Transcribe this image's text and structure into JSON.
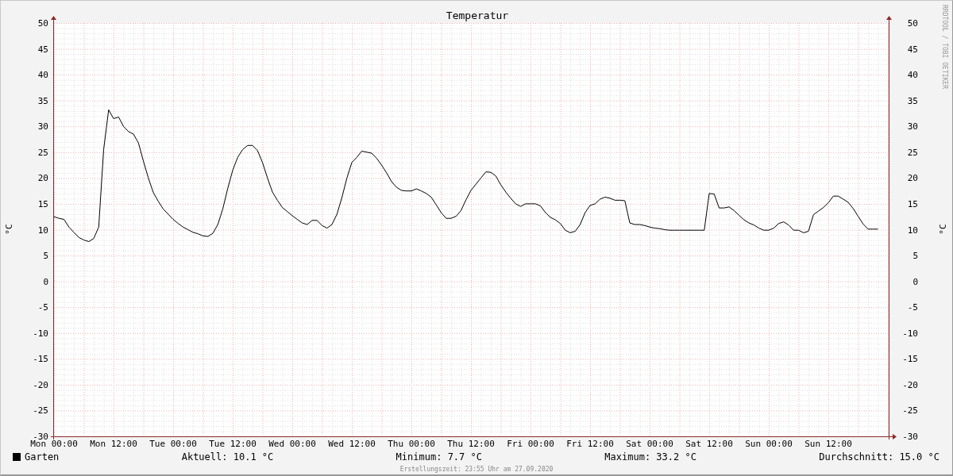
{
  "chart": {
    "chart_data": {
      "type": "line",
      "title": "Temperatur",
      "ylabel": "°C",
      "ylim": [
        -30,
        50
      ],
      "grid": true,
      "yticks": [
        -30,
        -25,
        -20,
        -15,
        -10,
        -5,
        0,
        5,
        10,
        15,
        20,
        25,
        30,
        35,
        40,
        45,
        50
      ],
      "categories": [
        "Mon 00:00",
        null,
        null,
        null,
        null,
        null,
        null,
        null,
        null,
        null,
        null,
        null,
        "Mon 12:00",
        null,
        null,
        null,
        null,
        null,
        null,
        null,
        null,
        null,
        null,
        null,
        "Tue 00:00",
        null,
        null,
        null,
        null,
        null,
        null,
        null,
        null,
        null,
        null,
        null,
        "Tue 12:00",
        null,
        null,
        null,
        null,
        null,
        null,
        null,
        null,
        null,
        null,
        null,
        "Wed 00:00",
        null,
        null,
        null,
        null,
        null,
        null,
        null,
        null,
        null,
        null,
        null,
        "Wed 12:00",
        null,
        null,
        null,
        null,
        null,
        null,
        null,
        null,
        null,
        null,
        null,
        "Thu 00:00",
        null,
        null,
        null,
        null,
        null,
        null,
        null,
        null,
        null,
        null,
        null,
        "Thu 12:00",
        null,
        null,
        null,
        null,
        null,
        null,
        null,
        null,
        null,
        null,
        null,
        "Fri 00:00",
        null,
        null,
        null,
        null,
        null,
        null,
        null,
        null,
        null,
        null,
        null,
        "Fri 12:00",
        null,
        null,
        null,
        null,
        null,
        null,
        null,
        null,
        null,
        null,
        null,
        "Sat 00:00",
        null,
        null,
        null,
        null,
        null,
        null,
        null,
        null,
        null,
        null,
        null,
        "Sat 12:00",
        null,
        null,
        null,
        null,
        null,
        null,
        null,
        null,
        null,
        null,
        null,
        "Sun 00:00",
        null,
        null,
        null,
        null,
        null,
        null,
        null,
        null,
        null,
        null,
        null,
        "Sun 12:00",
        null,
        null,
        null,
        null,
        null,
        null,
        null,
        null,
        null,
        null
      ],
      "series": [
        {
          "name": "Garten",
          "color": "#000000",
          "values": [
            12.5,
            12.2,
            12,
            10.5,
            9.5,
            8.5,
            8,
            7.7,
            8.3,
            10.5,
            25.5,
            33.2,
            31.5,
            31.8,
            30,
            29,
            28.5,
            26.8,
            23.3,
            20,
            17.2,
            15.5,
            14,
            13,
            12,
            11.2,
            10.5,
            10,
            9.5,
            9.2,
            8.8,
            8.7,
            9.3,
            11,
            14,
            18,
            21.5,
            24,
            25.5,
            26.3,
            26.3,
            25.3,
            23,
            20,
            17.3,
            15.7,
            14.3,
            13.5,
            12.7,
            12,
            11.3,
            11,
            11.8,
            11.8,
            10.8,
            10.3,
            11,
            13,
            16.2,
            20,
            23,
            24,
            25.2,
            25,
            24.8,
            23.8,
            22.5,
            21,
            19.3,
            18.2,
            17.6,
            17.5,
            17.5,
            17.9,
            17.5,
            17,
            16.3,
            14.8,
            13.3,
            12.2,
            12.2,
            12.6,
            13.7,
            15.8,
            17.6,
            18.8,
            20,
            21.2,
            21.1,
            20.4,
            18.7,
            17.3,
            16.1,
            15,
            14.5,
            15,
            15,
            15,
            14.6,
            13.3,
            12.4,
            11.9,
            11.2,
            9.9,
            9.4,
            9.7,
            11,
            13.3,
            14.7,
            15,
            15.9,
            16.3,
            16.1,
            15.7,
            15.7,
            15.6,
            11.3,
            11,
            11,
            10.8,
            10.5,
            10.3,
            10.2,
            10,
            9.9,
            9.9,
            9.9,
            9.9,
            9.9,
            9.9,
            9.9,
            9.9,
            17,
            16.9,
            14.2,
            14.2,
            14.4,
            13.7,
            12.8,
            11.9,
            11.3,
            10.9,
            10.3,
            9.9,
            9.9,
            10.3,
            11.2,
            11.5,
            10.9,
            9.9,
            9.9,
            9.4,
            9.7,
            12.9,
            13.6,
            14.3,
            15.2,
            16.5,
            16.5,
            15.9,
            15.3,
            14.1,
            12.6,
            11.1,
            10.1,
            10.1,
            10.1
          ]
        }
      ]
    },
    "right_axis": {
      "label": "°C",
      "ticks": [
        "50",
        "45",
        "40",
        "35",
        "30",
        "25",
        "20",
        "15",
        "10",
        "5",
        "0",
        "-5",
        "-10",
        "-15",
        "-20",
        "-25",
        "-30"
      ]
    },
    "tool_mark": "RRDTOOL / TOBI OETIKER"
  },
  "legend": {
    "stats": [
      "Aktuell: 10.1 °C",
      "Minimum: 7.7 °C",
      "Maximum: 33.2 °C",
      "Durchschnitt: 15.0 °C"
    ]
  },
  "footer": {
    "created": "Erstellungszeit: 23:55 Uhr am 27.09.2020"
  }
}
